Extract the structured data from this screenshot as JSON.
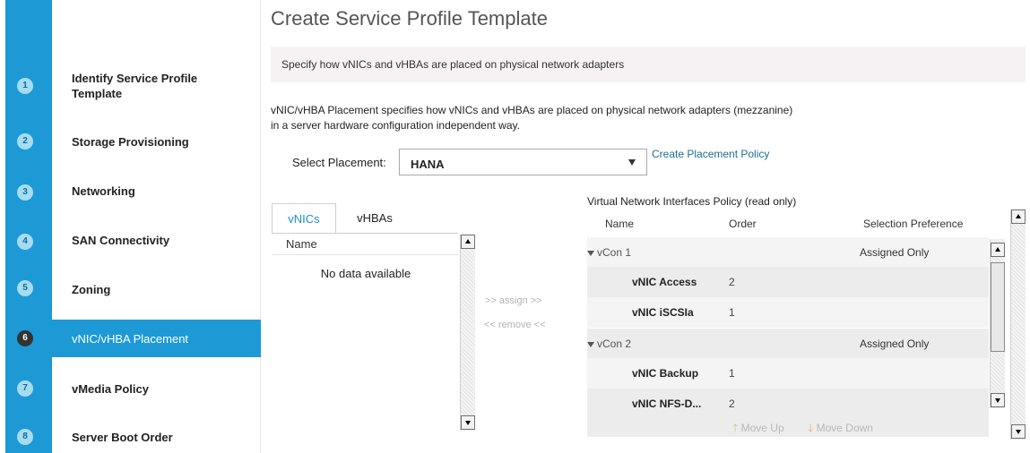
{
  "wizard": {
    "steps": [
      {
        "num": "1",
        "label": "Identify Service Profile Template"
      },
      {
        "num": "2",
        "label": "Storage Provisioning"
      },
      {
        "num": "3",
        "label": "Networking"
      },
      {
        "num": "4",
        "label": "SAN Connectivity"
      },
      {
        "num": "5",
        "label": "Zoning"
      },
      {
        "num": "6",
        "label": "vNIC/vHBA Placement"
      },
      {
        "num": "7",
        "label": "vMedia Policy"
      },
      {
        "num": "8",
        "label": "Server Boot Order"
      }
    ],
    "active_step": "6"
  },
  "page": {
    "title": "Create Service Profile Template",
    "banner": "Specify how vNICs and vHBAs are placed on physical network adapters",
    "description_line1": "vNIC/vHBA Placement specifies how vNICs and vHBAs are placed on physical network adapters (mezzanine)",
    "description_line2": "in a server hardware configuration independent way."
  },
  "placement": {
    "label": "Select Placement:",
    "selected": "HANA",
    "create_link": "Create Placement Policy"
  },
  "left_panel": {
    "tabs": [
      "vNICs",
      "vHBAs"
    ],
    "active_tab": "vNICs",
    "column": "Name",
    "empty_text": "No data available"
  },
  "actions": {
    "assign": ">> assign >>",
    "remove": "<< remove <<"
  },
  "policy": {
    "title": "Virtual Network Interfaces Policy (read only)",
    "columns": [
      "Name",
      "Order",
      "Selection Preference"
    ],
    "rows": [
      {
        "type": "group",
        "name": "vCon 1",
        "order": "",
        "pref": "Assigned Only"
      },
      {
        "type": "child",
        "name": "vNIC Access",
        "order": "2",
        "pref": ""
      },
      {
        "type": "child",
        "name": "vNIC iSCSIa",
        "order": "1",
        "pref": ""
      },
      {
        "type": "group",
        "name": "vCon 2",
        "order": "",
        "pref": "Assigned Only"
      },
      {
        "type": "child",
        "name": "vNIC Backup",
        "order": "1",
        "pref": ""
      },
      {
        "type": "child",
        "name": "vNIC NFS-D...",
        "order": "2",
        "pref": ""
      }
    ],
    "move_up": "Move Up",
    "move_down": "Move Down"
  },
  "colors": {
    "accent": "#1d9ad6",
    "link": "#1b6e94",
    "banner_bg": "#f6f1f3"
  }
}
